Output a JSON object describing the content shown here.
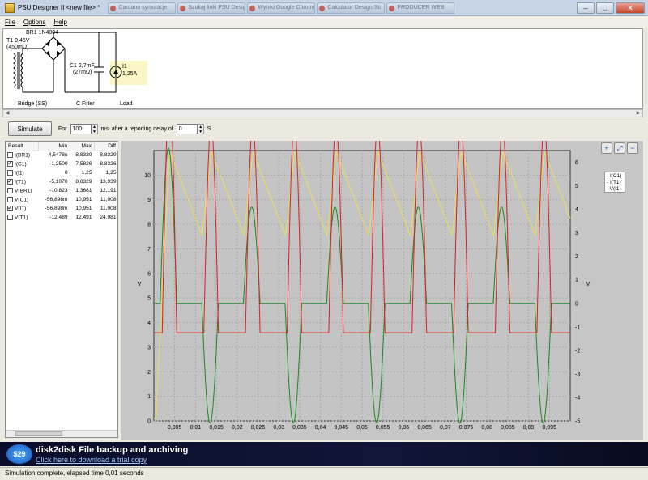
{
  "window": {
    "title": "PSU Designer II  <new file> *",
    "bg_tabs": [
      "Cardano symulacje",
      "Szukaj linki PSU Designer",
      "Wyniki Google Chrome",
      "Calculator Design Sti",
      "PRODUCER WEB"
    ],
    "controls": {
      "minimize": "–",
      "maximize": "□",
      "close": "✕"
    }
  },
  "menu": {
    "file": "File",
    "options": "Options",
    "help": "Help"
  },
  "schematic": {
    "rectifier": "BR1 1N4004",
    "transformer_name": "T1 9,45V",
    "transformer_res": "(450mΩ)",
    "cap_name": "C1 2,7mF",
    "cap_res": "(27mΩ)",
    "load_name": "I1",
    "load_value": "1,25A",
    "label_bridge": "Bridge (SS)",
    "label_filter": "C Filter",
    "label_load": "Load"
  },
  "simbar": {
    "simulate": "Simulate",
    "for": "For",
    "duration": "100",
    "ms": "ms",
    "delay_text": "after a reporting delay of",
    "delay": "0",
    "s": "S"
  },
  "results": {
    "headers": [
      "Result",
      "Min",
      "Max",
      "Diff"
    ],
    "rows": [
      {
        "checked": false,
        "name": "I(BR1)",
        "min": "-4,5478u",
        "max": "8,8329",
        "diff": "8,8329"
      },
      {
        "checked": true,
        "name": "I(C1)",
        "min": "-1,2500",
        "max": "7,5826",
        "diff": "8,8326"
      },
      {
        "checked": false,
        "name": "I(I1)",
        "min": "0",
        "max": "1,25",
        "diff": "1,25"
      },
      {
        "checked": true,
        "name": "I(T1)",
        "min": "-5,1070",
        "max": "8,8329",
        "diff": "13,939"
      },
      {
        "checked": false,
        "name": "V(BR1)",
        "min": "-10,823",
        "max": "1,3681",
        "diff": "12,191"
      },
      {
        "checked": false,
        "name": "V(C1)",
        "min": "-56,898m",
        "max": "10,951",
        "diff": "11,008"
      },
      {
        "checked": true,
        "name": "V(I1)",
        "min": "-56,898m",
        "max": "10,951",
        "diff": "11,008"
      },
      {
        "checked": false,
        "name": "V(T1)",
        "min": "-12,489",
        "max": "12,491",
        "diff": "24,981"
      }
    ]
  },
  "zoom": {
    "in": "+",
    "fit": "⤢",
    "out": "−"
  },
  "chart_data": {
    "type": "line",
    "xlabel": "",
    "ylabel": "V",
    "ylabel_right": "V",
    "x_ticks": [
      "0,005",
      "0,01",
      "0,015",
      "0,02",
      "0,025",
      "0,03",
      "0,035",
      "0,04",
      "0,045",
      "0,05",
      "0,055",
      "0,06",
      "0,065",
      "0,07",
      "0,075",
      "0,08",
      "0,085",
      "0,09",
      "0,095"
    ],
    "y_ticks_left": [
      "0",
      "1",
      "2",
      "3",
      "4",
      "5",
      "6",
      "7",
      "8",
      "9",
      "10"
    ],
    "y_ticks_right": [
      "-5",
      "-4",
      "-3",
      "-2",
      "-1",
      "0",
      "1",
      "2",
      "3",
      "4",
      "5",
      "6"
    ],
    "xlim": [
      0,
      0.1
    ],
    "ylim_left": [
      0,
      11
    ],
    "ylim_right": [
      -5,
      6.5
    ],
    "grid": true,
    "legend_position": "top-right",
    "series": [
      {
        "name": "I(C1)",
        "color": "#dd2020",
        "axis": "right",
        "period": 0.01,
        "base": -1.25,
        "peak": 7.58,
        "peak_first": 8.83,
        "pulse_start": 0.002,
        "pulse_width": 0.0035
      },
      {
        "name": "I(T1)",
        "color": "#1a8a1a",
        "axis": "right",
        "period": 0.02,
        "base": 0,
        "peak": 4.1,
        "peak_first": 6.6,
        "trough": -5.1
      },
      {
        "name": "V(I1)",
        "color": "#e8e050",
        "axis": "left",
        "period": 0.01,
        "max": 10.95,
        "min": 7.55,
        "rise_width": 0.0022
      }
    ]
  },
  "banner": {
    "badge": "$29",
    "title": "disk2disk File backup and archiving",
    "link": "Click here to download a trial copy"
  },
  "status": "Simulation complete, elapsed time 0,01 seconds"
}
